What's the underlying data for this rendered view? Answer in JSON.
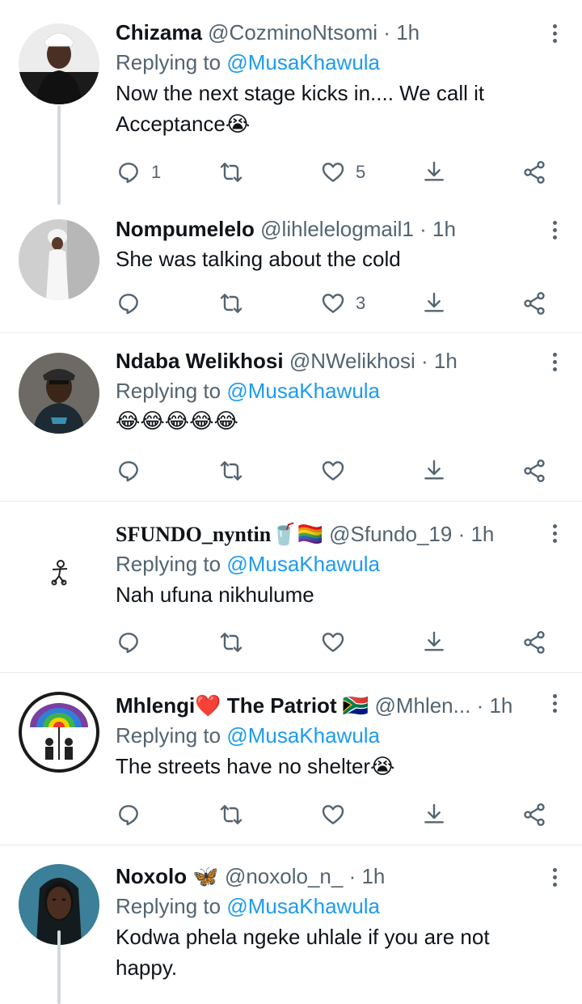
{
  "tweets": [
    {
      "name": "Chizama",
      "handle": "@CozminoNtsomi",
      "time": "1h",
      "replying_label": "Replying to",
      "mention": "@MusaKhawula",
      "text": "Now the next stage kicks in.... We call it Acceptance😭",
      "replies": "1",
      "likes": "5"
    },
    {
      "name": "Nompumelelo",
      "handle": "@lihlelelogmail1",
      "time": "1h",
      "replying_label": "",
      "mention": "",
      "text": "She was talking about the cold",
      "replies": "",
      "likes": "3"
    },
    {
      "name": "Ndaba Welikhosi",
      "handle": "@NWelikhosi",
      "time": "1h",
      "replying_label": "Replying to",
      "mention": "@MusaKhawula",
      "text": "😂😂😂😂😂",
      "replies": "",
      "likes": ""
    },
    {
      "name": "SFUNDO_nyntin🥤🏳️‍🌈",
      "handle": "@Sfundo_19",
      "time": "1h",
      "replying_label": "Replying to",
      "mention": "@MusaKhawula",
      "text": "Nah ufuna nikhulume",
      "replies": "",
      "likes": ""
    },
    {
      "name": "Mhlengi❤️ The Patriot 🇿🇦",
      "handle": "@Mhlen...",
      "time": "1h",
      "replying_label": "Replying to",
      "mention": "@MusaKhawula",
      "text": "The streets have no shelter😭",
      "replies": "",
      "likes": ""
    },
    {
      "name": "Noxolo 🦋",
      "handle": "@noxolo_n_",
      "time": "1h",
      "replying_label": "Replying to",
      "mention": "@MusaKhawula",
      "text": "Kodwa phela ngeke uhlale if you are not happy.",
      "replies": "",
      "likes": ""
    }
  ],
  "separator": "·",
  "colors": {
    "accent": "#1d9bf0",
    "secondary": "#536471",
    "divider": "#e6ecf0"
  },
  "icons": {
    "reply": "reply-icon",
    "retweet": "retweet-icon",
    "like": "heart-icon",
    "save": "download-icon",
    "share": "share-icon",
    "more": "more-vertical-icon"
  }
}
